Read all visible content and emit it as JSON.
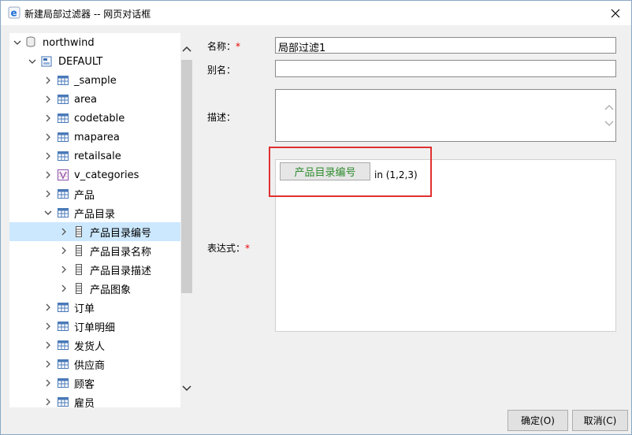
{
  "window": {
    "title": "新建局部过滤器 -- 网页对话框",
    "close_icon": "close-icon"
  },
  "tree": {
    "root": "northwind",
    "schema": "DEFAULT",
    "tables": [
      "_sample",
      "area",
      "codetable",
      "maparea",
      "retailsale",
      "v_categories",
      "产品",
      "产品目录"
    ],
    "columns": [
      "产品目录编号",
      "产品目录名称",
      "产品目录描述",
      "产品图象"
    ],
    "more_tables": [
      "订单",
      "订单明细",
      "发货人",
      "供应商",
      "顾客",
      "雇员"
    ]
  },
  "form": {
    "name_label": "名称：",
    "name_value": "局部过滤1",
    "alias_label": "别名：",
    "alias_value": "",
    "desc_label": "描述：",
    "expr_label": "表达式：",
    "required_mark": "*",
    "expr_field": "产品目录编号",
    "expr_rest": "in (1,2,3)"
  },
  "buttons": {
    "ok": "确定(O)",
    "cancel": "取消(C)"
  },
  "colors": {
    "selection": "#cce8ff",
    "required": "#e00000",
    "field_text": "#2e8b2e",
    "highlight": "#e03030"
  }
}
